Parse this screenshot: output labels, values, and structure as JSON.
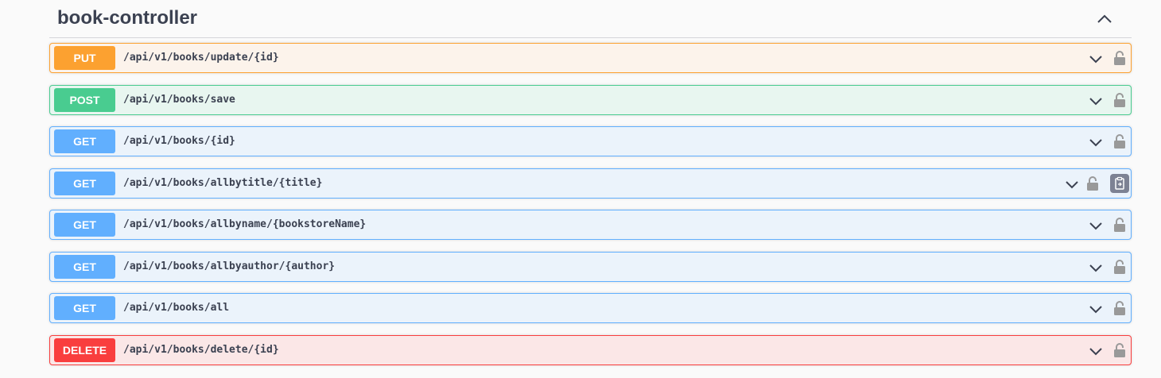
{
  "section": {
    "title": "book-controller",
    "collapse_icon": "chevron-up-icon"
  },
  "operations": [
    {
      "method": "PUT",
      "path": "/api/v1/books/update/{id}",
      "kind": "put"
    },
    {
      "method": "POST",
      "path": "/api/v1/books/save",
      "kind": "post"
    },
    {
      "method": "GET",
      "path": "/api/v1/books/{id}",
      "kind": "get"
    },
    {
      "method": "GET",
      "path": "/api/v1/books/allbytitle/{title}",
      "kind": "get",
      "has_copy": true
    },
    {
      "method": "GET",
      "path": "/api/v1/books/allbyname/{bookstoreName}",
      "kind": "get"
    },
    {
      "method": "GET",
      "path": "/api/v1/books/allbyauthor/{author}",
      "kind": "get"
    },
    {
      "method": "GET",
      "path": "/api/v1/books/all",
      "kind": "get"
    },
    {
      "method": "DELETE",
      "path": "/api/v1/books/delete/{id}",
      "kind": "delete"
    }
  ],
  "colors": {
    "put": "#fca130",
    "post": "#49cc90",
    "get": "#61affe",
    "delete": "#f93e3e",
    "text": "#3b4151",
    "icon": "#999999"
  }
}
